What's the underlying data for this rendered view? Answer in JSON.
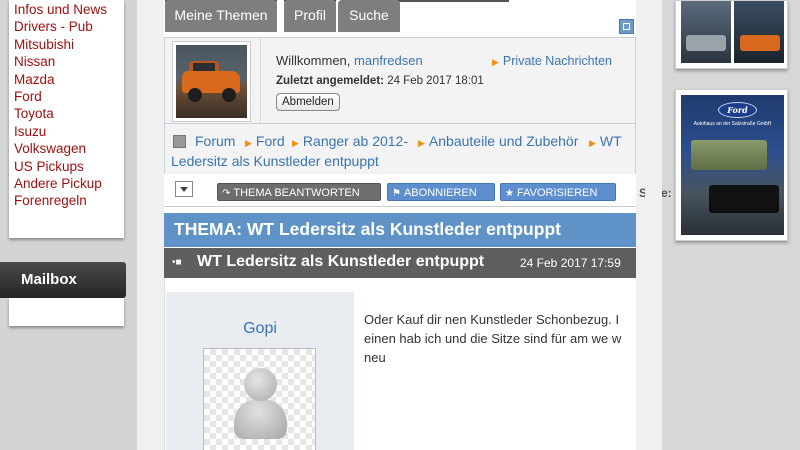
{
  "sidebar": {
    "menu_items": [
      {
        "label": "Infos und News"
      },
      {
        "label": "Drivers - Pub"
      },
      {
        "label": "Mitsubishi"
      },
      {
        "label": "Nissan"
      },
      {
        "label": "Mazda"
      },
      {
        "label": "Ford"
      },
      {
        "label": "Toyota"
      },
      {
        "label": "Isuzu"
      },
      {
        "label": "Volkswagen"
      },
      {
        "label": "US Pickups"
      },
      {
        "label": "Andere Pickup"
      },
      {
        "label": "Forenregeln"
      }
    ],
    "mailbox_title": "Mailbox"
  },
  "tabs": [
    {
      "label": "Meine Themen"
    },
    {
      "label": "Profil"
    },
    {
      "label": "Suche"
    }
  ],
  "user_panel": {
    "welcome_prefix": "Willkommen,",
    "username": "manfredsen",
    "private_messages": "Private Nachrichten",
    "last_login_label": "Zuletzt angemeldet:",
    "last_login_value": "24 Feb 2017 18:01",
    "logout_label": "Abmelden"
  },
  "breadcrumb": {
    "items": [
      {
        "label": "Forum"
      },
      {
        "label": "Ford"
      },
      {
        "label": "Ranger ab 2012-"
      },
      {
        "label": "Anbauteile und Zubehör"
      },
      {
        "label": "WT"
      },
      {
        "label": "Ledersitz als Kunstleder entpuppt"
      }
    ]
  },
  "actions": {
    "reply": "THEMA BEANTWORTEN",
    "subscribe": "ABONNIEREN",
    "favorite": "FAVORISIEREN",
    "page_label": "Seite:"
  },
  "thread": {
    "header": "THEMA: WT Ledersitz als Kunstleder entpuppt"
  },
  "post": {
    "title": "WT Ledersitz als Kunstleder entpuppt",
    "date": "24 Feb 2017 17:59",
    "author": "Gopi",
    "text_lines": [
      "Oder Kauf dir nen Kunstleder Schonbezug. I",
      "einen hab ich und die Sitze sind für am we w",
      "neu"
    ]
  },
  "ad": {
    "brand": "Ford",
    "tagline": "Autohaus an der Salzstraße GmbH"
  },
  "colors": {
    "menu_link": "#a01010",
    "link_blue": "#3b74b3",
    "thread_header": "#5f93c8",
    "post_header": "#5e5e5e",
    "arrow_orange": "#f09010"
  }
}
